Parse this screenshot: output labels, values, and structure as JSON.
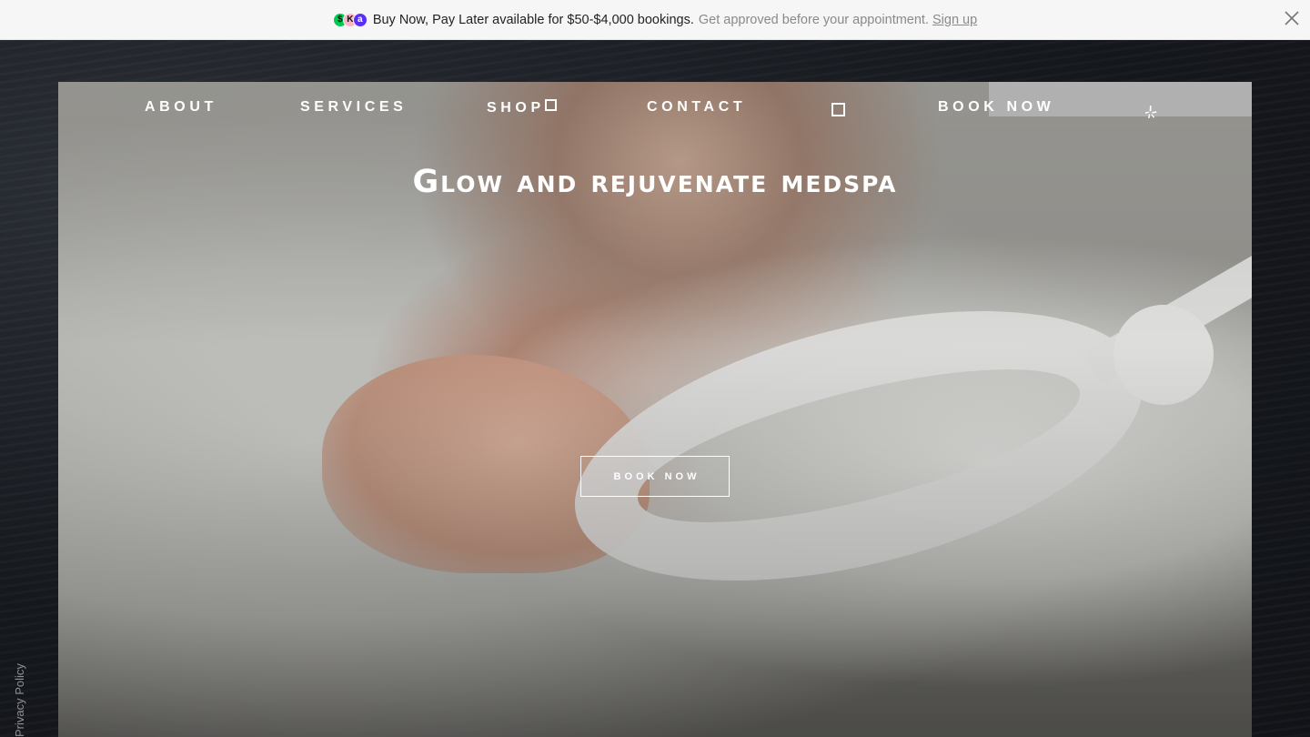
{
  "banner": {
    "main_text": "Buy Now, Pay Later available for $50-$4,000 bookings.",
    "secondary_text": "Get approved before your appointment.",
    "signup_label": "Sign up",
    "logos": [
      "$",
      "K",
      "a"
    ],
    "close_icon": "close-icon"
  },
  "sidebar": {
    "privacy_label": "Privacy Policy"
  },
  "nav": {
    "about": "ABOUT",
    "services": "SERVICES",
    "shop": "SHOP",
    "contact": "CONTACT",
    "book_now": "BOOK NOW",
    "icons": [
      "box-icon",
      "yelp-icon"
    ]
  },
  "hero": {
    "title": "Glow and rejuvenate medspa",
    "cta_label": "BOOK NOW"
  },
  "colors": {
    "banner_bg": "#f6f6f6",
    "page_bg": "#15171b",
    "nav_text": "#ffffff",
    "muted_text": "#8a8a8a"
  }
}
